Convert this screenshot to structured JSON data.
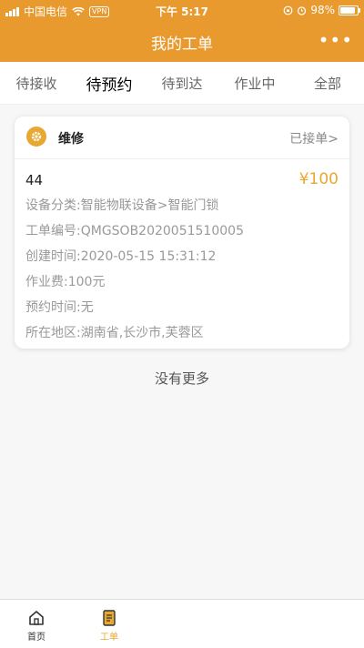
{
  "statusbar": {
    "carrier": "中国电信",
    "vpn": "VPN",
    "time": "下午 5:17",
    "battery": "98%"
  },
  "navbar": {
    "title": "我的工单",
    "more": "•••"
  },
  "tabs": [
    {
      "label": "待接收",
      "active": false
    },
    {
      "label": "待预约",
      "active": true
    },
    {
      "label": "待到达",
      "active": false
    },
    {
      "label": "作业中",
      "active": false
    },
    {
      "label": "全部",
      "active": false
    }
  ],
  "order": {
    "category": "维修",
    "status": "已接单>",
    "id": "44",
    "price": "¥100",
    "fields": [
      {
        "label": "设备分类:",
        "value": "智能物联设备>智能门锁"
      },
      {
        "label": "工单编号:",
        "value": "QMGSOB2020051510005"
      },
      {
        "label": "创建时间:",
        "value": "2020-05-15 15:31:12"
      },
      {
        "label": "作业费:",
        "value": "100元"
      },
      {
        "label": "预约时间:",
        "value": "无"
      },
      {
        "label": "所在地区:",
        "value": "湖南省,长沙市,芙蓉区"
      }
    ]
  },
  "list_end_text": "没有更多",
  "tabbar": [
    {
      "label": "首页",
      "icon": "home-icon",
      "active": false
    },
    {
      "label": "工单",
      "icon": "order-icon",
      "active": true
    }
  ],
  "colors": {
    "accent": "#e89a2f",
    "price": "#e8a82f"
  }
}
